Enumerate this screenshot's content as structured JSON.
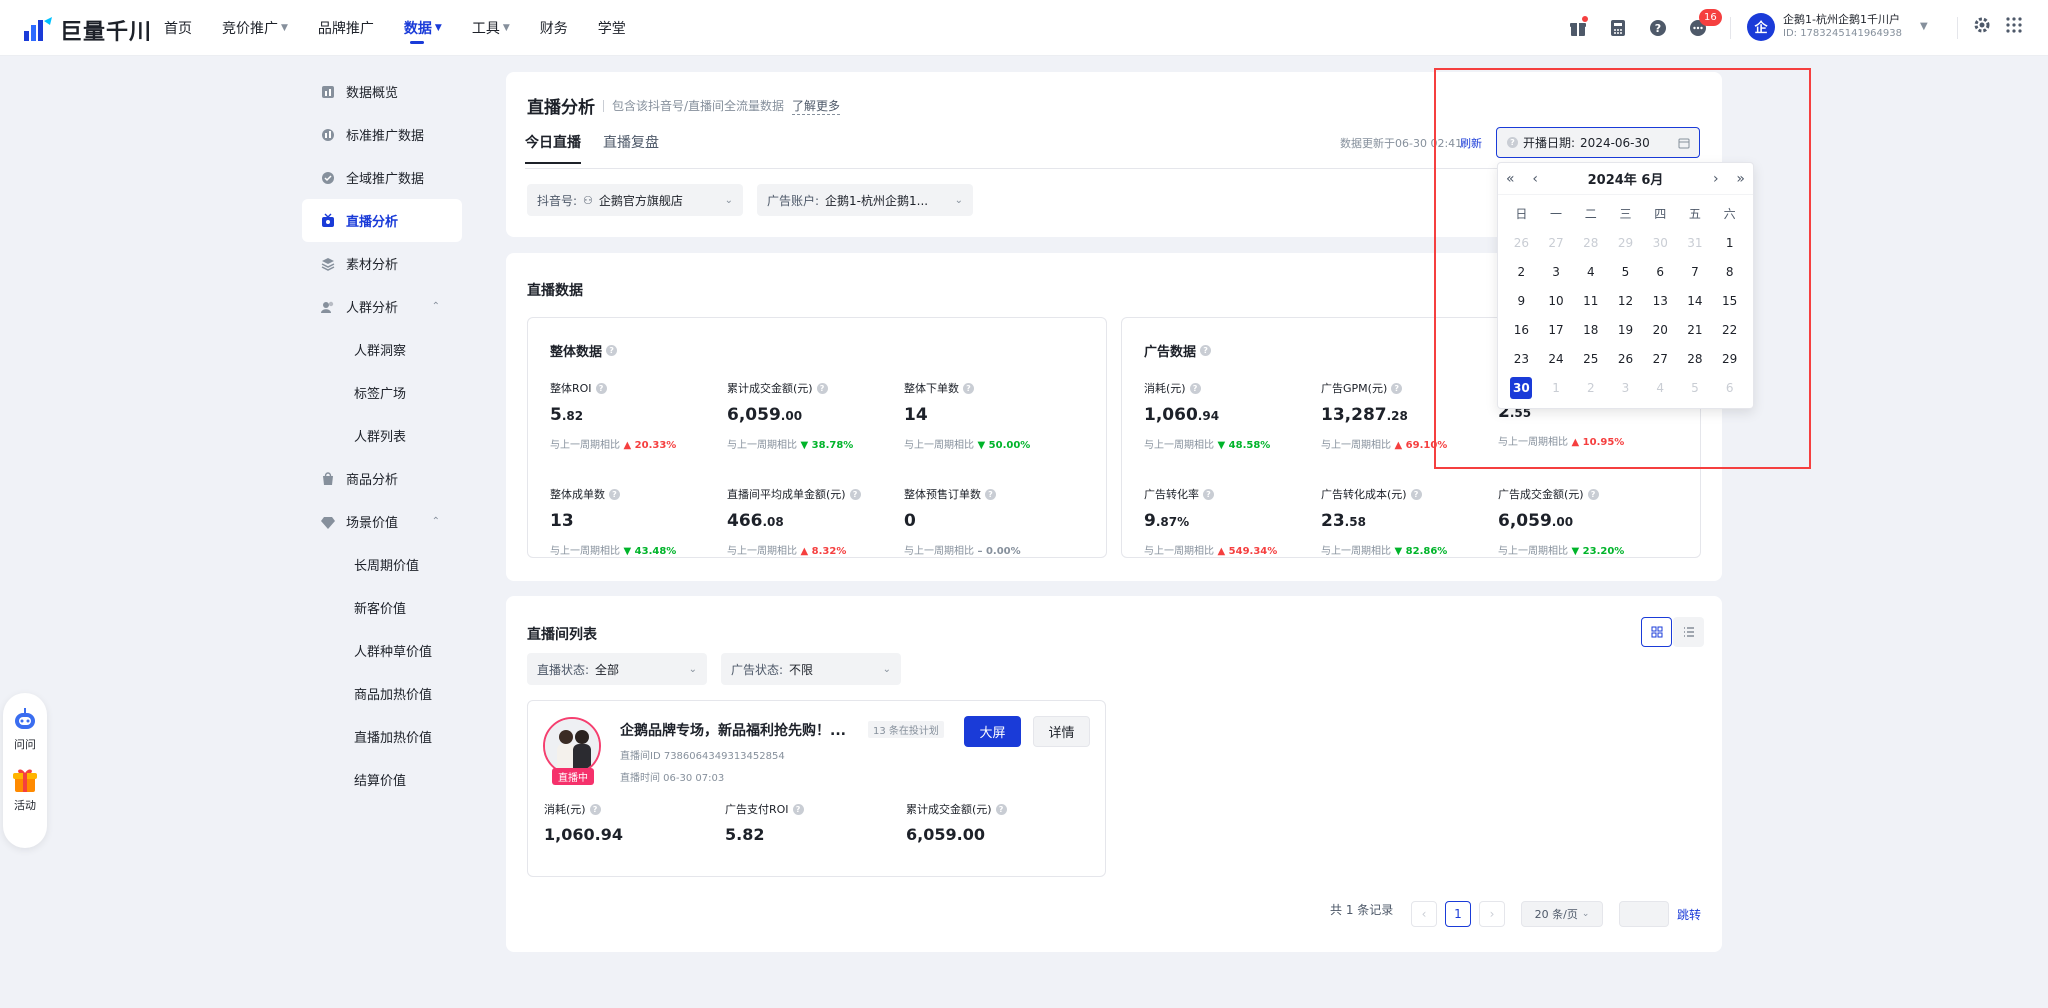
{
  "header": {
    "logo_text": "巨量千川",
    "nav": [
      {
        "label": "首页",
        "caret": false,
        "active": false
      },
      {
        "label": "竞价推广",
        "caret": true,
        "active": false
      },
      {
        "label": "品牌推广",
        "caret": false,
        "active": false
      },
      {
        "label": "数据",
        "caret": true,
        "active": true
      },
      {
        "label": "工具",
        "caret": true,
        "active": false
      },
      {
        "label": "财务",
        "caret": false,
        "active": false
      },
      {
        "label": "学堂",
        "caret": false,
        "active": false
      }
    ],
    "notification_count": "16",
    "account_avatar": "企",
    "account_name": "企鹅1-杭州企鹅1千川户",
    "account_id": "ID: 1783245141964938"
  },
  "sidebar": {
    "items": [
      {
        "label": "数据概览",
        "icon": "overview-icon"
      },
      {
        "label": "标准推广数据",
        "icon": "standard-data-icon"
      },
      {
        "label": "全域推广数据",
        "icon": "global-data-icon"
      },
      {
        "label": "直播分析",
        "icon": "live-icon",
        "active": true
      },
      {
        "label": "素材分析",
        "icon": "material-icon"
      },
      {
        "label": "人群分析",
        "icon": "crowd-icon",
        "expanded": true
      },
      {
        "label": "人群洞察",
        "sub": true
      },
      {
        "label": "标签广场",
        "sub": true
      },
      {
        "label": "人群列表",
        "sub": true
      },
      {
        "label": "商品分析",
        "icon": "goods-icon"
      },
      {
        "label": "场景价值",
        "icon": "diamond-icon",
        "expanded": true
      },
      {
        "label": "长周期价值",
        "sub": true
      },
      {
        "label": "新客价值",
        "sub": true
      },
      {
        "label": "人群种草价值",
        "sub": true
      },
      {
        "label": "商品加热价值",
        "sub": true
      },
      {
        "label": "直播加热价值",
        "sub": true
      },
      {
        "label": "结算价值",
        "sub": true
      }
    ]
  },
  "page": {
    "title": "直播分析",
    "subtitle": "包含该抖音号/直播间全流量数据",
    "learn_more": "了解更多",
    "tabs": [
      "今日直播",
      "直播复盘"
    ],
    "update_text": "数据更新于06-30 02:41",
    "refresh": "刷新",
    "date_label": "开播日期:",
    "date_value": "2024-06-30",
    "douyin_label": "抖音号:",
    "douyin_value": "企鹅官方旗舰店",
    "ad_account_label": "广告账户:",
    "ad_account_value": "企鹅1-杭州企鹅1..."
  },
  "calendar": {
    "title": "2024年 6月",
    "weekdays": [
      "日",
      "一",
      "二",
      "三",
      "四",
      "五",
      "六"
    ],
    "days": [
      [
        "26",
        "27",
        "28",
        "29",
        "30",
        "31",
        "1"
      ],
      [
        "2",
        "3",
        "4",
        "5",
        "6",
        "7",
        "8"
      ],
      [
        "9",
        "10",
        "11",
        "12",
        "13",
        "14",
        "15"
      ],
      [
        "16",
        "17",
        "18",
        "19",
        "20",
        "21",
        "22"
      ],
      [
        "23",
        "24",
        "25",
        "26",
        "27",
        "28",
        "29"
      ],
      [
        "30",
        "1",
        "2",
        "3",
        "4",
        "5",
        "6"
      ]
    ],
    "selected": "30"
  },
  "live_data": {
    "title": "直播数据",
    "overall": {
      "title": "整体数据",
      "compare_label": "与上一周期相比",
      "metrics": [
        {
          "label": "整体ROI",
          "int": "5",
          "dec": ".82",
          "trend": "up",
          "change": "20.33%"
        },
        {
          "label": "累计成交金额(元)",
          "int": "6,059",
          "dec": ".00",
          "trend": "down",
          "change": "38.78%"
        },
        {
          "label": "整体下单数",
          "int": "14",
          "dec": "",
          "trend": "down",
          "change": "50.00%"
        },
        {
          "label": "整体成单数",
          "int": "13",
          "dec": "",
          "trend": "down",
          "change": "43.48%"
        },
        {
          "label": "直播间平均成单金额(元)",
          "int": "466",
          "dec": ".08",
          "trend": "up",
          "change": "8.32%"
        },
        {
          "label": "整体预售订单数",
          "int": "0",
          "dec": "",
          "trend": "flat",
          "change": "0.00%"
        }
      ]
    },
    "ad": {
      "title": "广告数据",
      "compare_label": "与上一周期相比",
      "metrics": [
        {
          "label": "消耗(元)",
          "int": "1,060",
          "dec": ".94",
          "trend": "down",
          "change": "48.58%"
        },
        {
          "label": "广告GPM(元)",
          "int": "13,287",
          "dec": ".28",
          "trend": "up",
          "change": "69.10%"
        },
        {
          "label": "",
          "int": "2",
          "dec": ".55",
          "trend": "up",
          "change": "10.95%"
        },
        {
          "label": "广告转化率",
          "int": "9",
          "dec": ".87%",
          "trend": "up",
          "change": "549.34%"
        },
        {
          "label": "广告转化成本(元)",
          "int": "23",
          "dec": ".58",
          "trend": "down",
          "change": "82.86%"
        },
        {
          "label": "广告成交金额(元)",
          "int": "6,059",
          "dec": ".00",
          "trend": "down",
          "change": "23.20%"
        }
      ]
    }
  },
  "room_list": {
    "title": "直播间列表",
    "filter_live_label": "直播状态:",
    "filter_live_value": "全部",
    "filter_ad_label": "广告状态:",
    "filter_ad_value": "不限",
    "room": {
      "name": "企鹅品牌专场，新品福利抢先购！...",
      "plan_tag": "13 条在投计划",
      "live_badge": "直播中",
      "room_id": "直播间ID  7386064349313452854",
      "live_time": "直播时间  06-30 07:03",
      "big_screen": "大屏",
      "detail": "详情",
      "stats": [
        {
          "label": "消耗(元)",
          "value": "1,060.94"
        },
        {
          "label": "广告支付ROI",
          "value": "5.82"
        },
        {
          "label": "累计成交金额(元)",
          "value": "6,059.00"
        }
      ]
    },
    "pager": {
      "total": "共 1 条记录",
      "page": "1",
      "page_size": "20 条/页",
      "jump": "跳转"
    }
  },
  "floatbar": {
    "ask": "问问",
    "activity": "活动"
  }
}
